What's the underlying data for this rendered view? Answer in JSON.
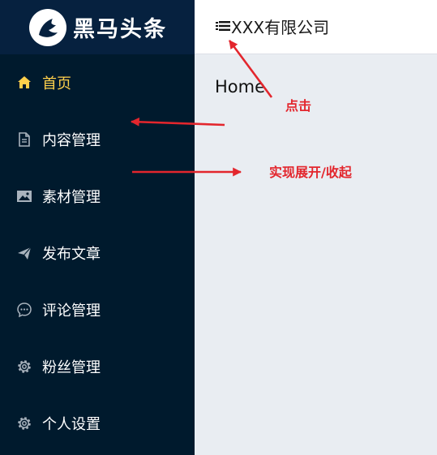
{
  "logo": {
    "text": "黑马头条"
  },
  "header": {
    "company": "XXX有限公司",
    "toggle_icon": "fold-menu-icon"
  },
  "sidebar": {
    "items": [
      {
        "label": "首页",
        "icon": "home-icon",
        "active": true
      },
      {
        "label": "内容管理",
        "icon": "document-icon",
        "active": false
      },
      {
        "label": "素材管理",
        "icon": "picture-icon",
        "active": false
      },
      {
        "label": "发布文章",
        "icon": "paper-plane-icon",
        "active": false
      },
      {
        "label": "评论管理",
        "icon": "chat-icon",
        "active": false
      },
      {
        "label": "粉丝管理",
        "icon": "gear-icon",
        "active": false
      },
      {
        "label": "个人设置",
        "icon": "gear-icon",
        "active": false
      }
    ]
  },
  "main": {
    "content": "Home"
  },
  "annotations": {
    "click": "点击",
    "expand_collapse": "实现展开/收起"
  },
  "colors": {
    "sidebar_bg": "#001a2d",
    "logo_bg": "#06213f",
    "active_text": "#ffd04b",
    "annotation": "#e3262d",
    "content_bg": "#e9edf2"
  }
}
